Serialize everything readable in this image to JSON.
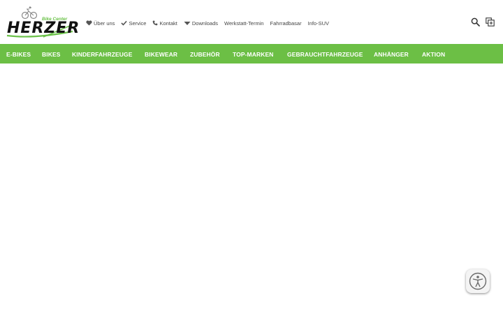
{
  "logo": {
    "brand": "HERZER",
    "tagline": "Bike Center"
  },
  "topnav": [
    {
      "label": "Über uns",
      "icon": "heart-icon"
    },
    {
      "label": "Service",
      "icon": "check-icon"
    },
    {
      "label": "Kontakt",
      "icon": "phone-icon"
    },
    {
      "label": "Downloads",
      "icon": "caret-down-icon"
    },
    {
      "label": "Werkstatt-Termin",
      "icon": ""
    },
    {
      "label": "Fahrradbasar",
      "icon": ""
    },
    {
      "label": "Info-SUV",
      "icon": ""
    }
  ],
  "tools": {
    "search_icon": "search-icon",
    "compare_icon": "compare-icon"
  },
  "mainnav": [
    "E-BIKES",
    "BIKES",
    "KINDERFAHRZEUGE",
    "BIKEWEAR",
    "ZUBEHÖR",
    "TOP-MARKEN",
    "GEBRAUCHTFAHRZEUGE",
    "ANHÄNGER",
    "AKTION"
  ],
  "colors": {
    "accent": "#6cbf45",
    "nav_text": "#444444",
    "background": "#ffffff"
  },
  "accessibility_widget": {
    "icon": "accessibility-icon"
  }
}
